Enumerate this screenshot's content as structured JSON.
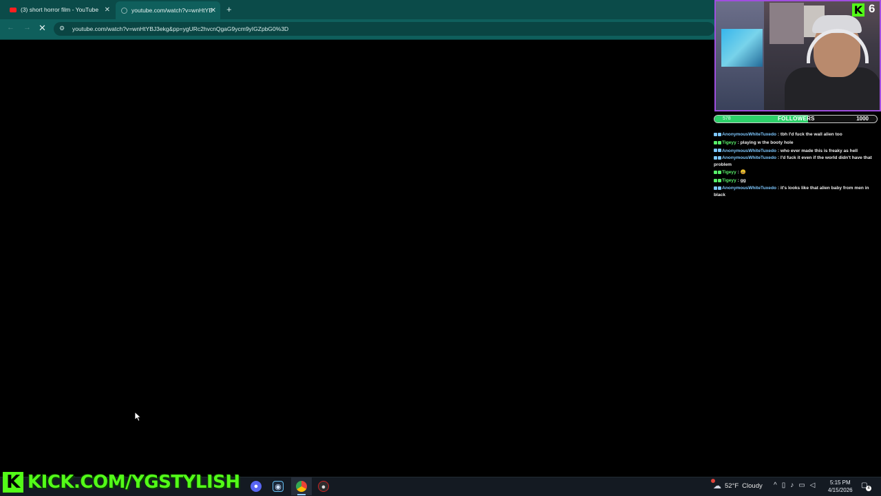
{
  "browser": {
    "tabs": [
      {
        "title": "(3) short horror film - YouTube",
        "active": false
      },
      {
        "title": "youtube.com/watch?v=wnHtYB",
        "active": true
      }
    ],
    "new_tab_label": "+",
    "close_glyph": "✕",
    "url": "youtube.com/watch?v=wnHtYBJ3ekg&pp=ygURc2hvcnQgaG9ycm9yIGZpbG0%3D"
  },
  "overlay": {
    "kick_viewer_count": "6",
    "followers": {
      "current": "578",
      "label": "FOLLOWERS",
      "goal": "1000",
      "progress_fraction": 0.578
    },
    "watermark": "KICK.COM/YGSTYLISH",
    "chat": [
      {
        "user": "AnonymousWhiteTuxedo",
        "message": "tbh I'd fuck the wall alien too",
        "user_color": "#7ec8ff"
      },
      {
        "user": "Tigeyy",
        "message": "playing w the booty hole",
        "user_color": "#58f06a"
      },
      {
        "user": "AnonymousWhiteTuxedo",
        "message": "who ever made this is freaky as hell",
        "user_color": "#7ec8ff"
      },
      {
        "user": "AnonymousWhiteTuxedo",
        "message": "I'd fuck it even if the world didn't have that problem",
        "user_color": "#7ec8ff"
      },
      {
        "user": "Tigeyy",
        "message": "😀",
        "user_color": "#58f06a"
      },
      {
        "user": "Tigeyy",
        "message": "gg",
        "user_color": "#58f06a"
      },
      {
        "user": "AnonymousWhiteTuxedo",
        "message": "it's looks like that alien baby from men in black",
        "user_color": "#7ec8ff"
      }
    ]
  },
  "taskbar": {
    "weather": {
      "temp": "52°F",
      "condition": "Cloudy"
    },
    "clock": {
      "time": "5:15 PM",
      "date": "4/15/2026"
    },
    "notification_count": "4",
    "apps": [
      "discord-icon",
      "steam-icon",
      "chrome-icon",
      "obs-icon"
    ]
  },
  "colors": {
    "kick_green": "#53fc18",
    "tab_bg": "#0b4b49",
    "toolbar_bg": "#0f5f5c"
  }
}
